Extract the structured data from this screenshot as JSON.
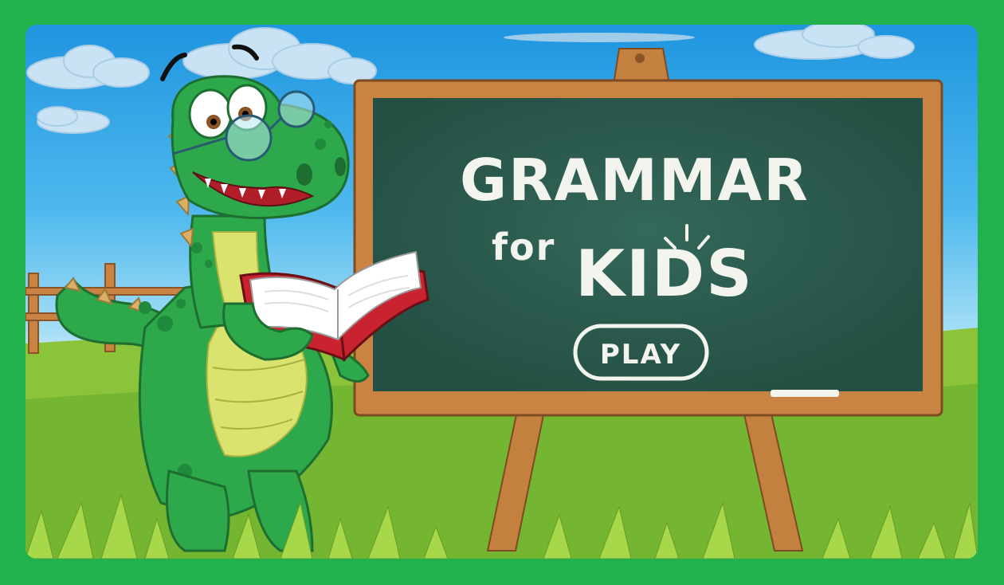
{
  "title": {
    "line1": "GRAMMAR",
    "line2_prefix": "for",
    "line2_main": "KIDS"
  },
  "play_button": {
    "label": "PLAY"
  },
  "colors": {
    "frame_green": "#22b14c",
    "chalkboard": "#2a5a4d",
    "board_frame": "#c98444",
    "dino_green": "#2da84a",
    "dino_belly": "#d9e36e",
    "book_red": "#c8232e",
    "chalk": "#f4f4ef"
  },
  "icons": [
    "dinosaur-mascot",
    "open-book-icon",
    "glasses-icon",
    "chalk-icon",
    "cloud-icon",
    "fence-icon"
  ]
}
